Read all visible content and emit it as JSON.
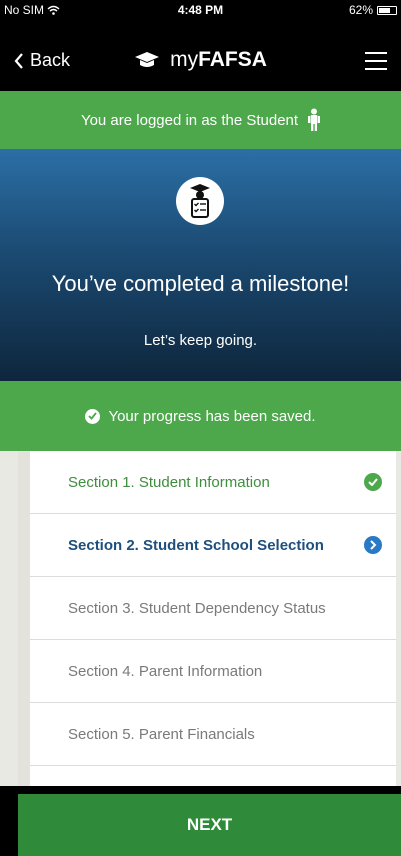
{
  "status_bar": {
    "carrier": "No SIM",
    "time": "4:48 PM",
    "battery": "62%"
  },
  "nav": {
    "back_label": "Back",
    "brand_prefix": "my",
    "brand_bold": "FAFSA"
  },
  "logged_in": {
    "text": "You are logged in as the Student"
  },
  "hero": {
    "title": "You’ve completed a milestone!",
    "subtitle": "Let’s keep going."
  },
  "saved": {
    "text": "Your progress has been saved."
  },
  "sections": [
    {
      "label": "Section 1. Student Information",
      "state": "complete"
    },
    {
      "label": "Section 2. Student School Selection",
      "state": "current"
    },
    {
      "label": "Section 3. Student Dependency Status",
      "state": "pending"
    },
    {
      "label": "Section 4. Parent Information",
      "state": "pending"
    },
    {
      "label": "Section 5. Parent Financials",
      "state": "pending"
    }
  ],
  "next_button": {
    "label": "NEXT"
  },
  "colors": {
    "green": "#4ca84b",
    "blue": "#2a79c4",
    "navy": "#1e4f7d",
    "next_green": "#2f8b3a"
  },
  "icons": [
    "wifi-icon",
    "battery-icon",
    "chevron-left-icon",
    "graduation-cap-icon",
    "hamburger-menu-icon",
    "student-figure-icon",
    "checklist-badge-icon",
    "check-circle-icon",
    "chevron-right-circle-icon"
  ]
}
